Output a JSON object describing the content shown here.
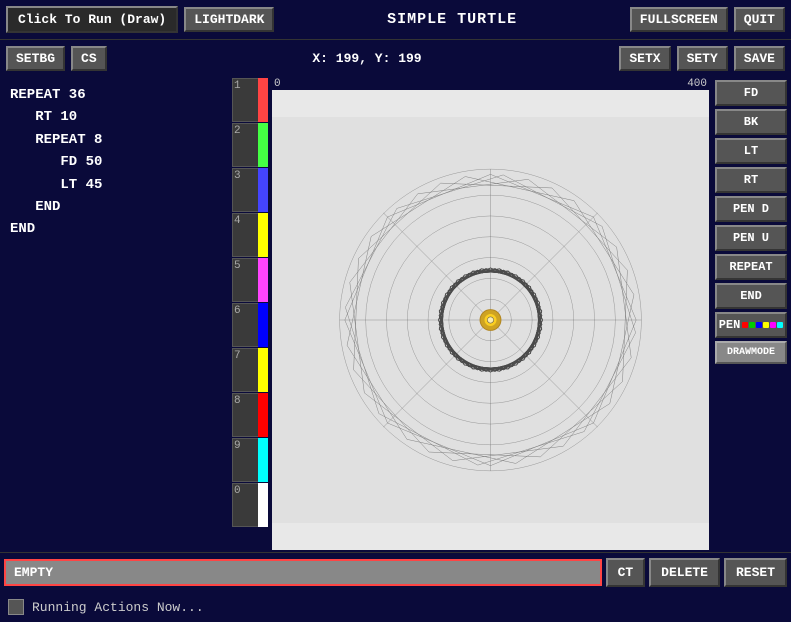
{
  "topbar": {
    "click_run_label": "Click To Run (Draw)",
    "lightdark_label": "LIGHTDARK",
    "title": "SIMPLE TURTLE",
    "fullscreen_label": "FULLSCREEN",
    "quit_label": "QUIT"
  },
  "secondbar": {
    "setbg_label": "SETBG",
    "cs_label": "CS",
    "coords": "X: 199, Y: 199",
    "setx_label": "SETX",
    "sety_label": "SETY",
    "save_label": "SAVE"
  },
  "code": {
    "lines": [
      "REPEAT 36",
      "   RT 10",
      "   REPEAT 8",
      "      FD 50",
      "      LT 45",
      "   END",
      "END"
    ]
  },
  "ruler": {
    "left": "0",
    "right": "400"
  },
  "palette": [
    {
      "number": "1",
      "color_class": "c1"
    },
    {
      "number": "2",
      "color_class": "c2"
    },
    {
      "number": "3",
      "color_class": "c3"
    },
    {
      "number": "4",
      "color_class": "c4"
    },
    {
      "number": "5",
      "color_class": "c5"
    },
    {
      "number": "6",
      "color_class": "c6"
    },
    {
      "number": "7",
      "color_class": "c7"
    },
    {
      "number": "8",
      "color_class": "c8"
    },
    {
      "number": "9",
      "color_class": "c9"
    },
    {
      "number": "0",
      "color_class": "c10"
    }
  ],
  "right_panel": {
    "buttons": [
      "FD",
      "BK",
      "LT",
      "RT",
      "PEN D",
      "PEN U",
      "REPEAT",
      "END"
    ],
    "pen_label": "PEN",
    "drawmode_label": "DRAWMODE"
  },
  "bottom": {
    "input_value": "EMPTY",
    "ct_label": "CT",
    "delete_label": "DELETE",
    "reset_label": "RESET"
  },
  "status": {
    "text": "Running Actions Now..."
  },
  "pen_colors": [
    "#ff0000",
    "#00aa00",
    "#0000ff",
    "#ffff00",
    "#ff00ff",
    "#00ffff"
  ]
}
